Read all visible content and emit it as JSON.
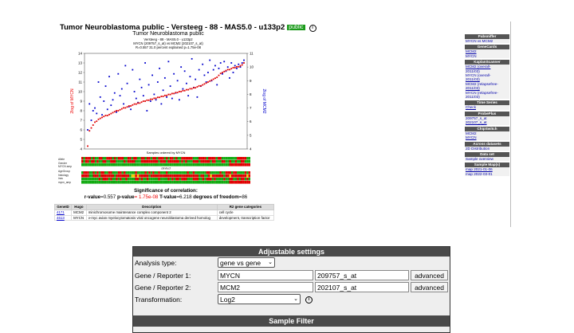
{
  "page": {
    "title": "Tumor Neuroblastoma public - Versteeg - 88 - MAS5.0 - u133p2",
    "badge": "public",
    "info_icon": "info-icon"
  },
  "chart_header": {
    "title": "Tumor Neuroblastoma public",
    "line2": "Versteeg - 88 - MAS5.0 - u133p2",
    "line3": "MYCN (209757_s_at) vs MCM2 (202107_s_at)",
    "line4": "R=0.557 31.0 percent explained p=1.75e-08"
  },
  "chart_data": {
    "type": "scatter",
    "xlabel": "Samples ordered by MYCN",
    "ylabel_left": "2log of MYCN",
    "ylabel_right": "2log of MCM2",
    "ylim_left": [
      4,
      14
    ],
    "yticks_left": [
      "14",
      "13",
      "12",
      "11",
      "10",
      "9",
      "8",
      "7",
      "6",
      "5",
      "4"
    ],
    "ylim_right": [
      4,
      11
    ],
    "yticks_right": [
      "11",
      "10",
      "9",
      "8",
      "7",
      "6",
      "5",
      "4"
    ],
    "series": [
      {
        "name": "MYCN",
        "color": "#e00000",
        "values": [
          4.3,
          5.9,
          6.2,
          6.5,
          6.8,
          6.9,
          7.1,
          7.2,
          7.3,
          7.4,
          7.5,
          7.5,
          7.6,
          7.7,
          7.8,
          7.9,
          8.0,
          8.0,
          8.1,
          8.2,
          8.3,
          8.3,
          8.4,
          8.5,
          8.5,
          8.6,
          8.7,
          8.7,
          8.8,
          8.8,
          8.9,
          9.0,
          9.0,
          9.1,
          9.1,
          9.2,
          9.2,
          9.3,
          9.3,
          9.4,
          9.4,
          9.5,
          9.5,
          9.6,
          9.6,
          9.7,
          9.7,
          9.8,
          9.8,
          9.9,
          9.9,
          10.0,
          10.0,
          10.1,
          10.1,
          10.2,
          10.2,
          10.3,
          10.3,
          10.4,
          10.4,
          10.5,
          10.6,
          10.6,
          10.7,
          10.8,
          10.9,
          11.0,
          11.1,
          11.2,
          11.3,
          11.4,
          11.5,
          11.7,
          11.9,
          12.0,
          12.1,
          12.2,
          12.3,
          12.3,
          12.4,
          12.5,
          12.5,
          12.6,
          12.6,
          12.7,
          12.8,
          13.0
        ]
      },
      {
        "name": "MCM2",
        "color": "#0000cc",
        "values": [
          5.4,
          7.3,
          6.1,
          6.8,
          7.0,
          6.6,
          8.9,
          7.8,
          6.5,
          7.5,
          8.6,
          6.9,
          9.3,
          7.2,
          7.6,
          8.1,
          6.7,
          9.5,
          7.9,
          8.4,
          7.3,
          10.1,
          8.8,
          7.1,
          6.9,
          9.8,
          8.2,
          7.7,
          7.4,
          9.1,
          8.5,
          7.9,
          10.3,
          6.8,
          8.7,
          7.5,
          9.4,
          8.0,
          7.6,
          8.9,
          9.9,
          7.3,
          8.3,
          9.2,
          7.8,
          10.4,
          8.6,
          7.7,
          9.5,
          8.1,
          9.0,
          7.6,
          10.0,
          8.4,
          9.7,
          8.8,
          7.9,
          9.3,
          10.6,
          8.5,
          9.1,
          7.8,
          9.8,
          8.6,
          10.2,
          9.4,
          8.9,
          9.6,
          10.5,
          9.0,
          9.8,
          10.1,
          8.7,
          9.9,
          10.3,
          9.5,
          10.4,
          9.7,
          10.0,
          9.2,
          10.3,
          9.6,
          10.1,
          9.9,
          10.2,
          10.0,
          10.3,
          10.5
        ]
      }
    ]
  },
  "heatmap": {
    "labels_top": [
      "Allele",
      "Gender",
      "MYCN amp"
    ],
    "mid_label": "clin/lecf",
    "labels_bottom": [
      "AgeGroup",
      "histology",
      "inss",
      "mycn_amp"
    ],
    "colors": {
      "red": "#e00000",
      "green": "#11aa11",
      "yellow": "#eecc00",
      "blue": "#2222aa"
    }
  },
  "correlation": {
    "heading": "Significance of correlation:",
    "r_label": "r-value",
    "r_value": "=0.557",
    "p_label": "p-value",
    "p_value": "= 1.75e-08",
    "t_label": "T-value",
    "t_value": "=6.218",
    "dof_label": "degrees of freedom",
    "dof_value": "=86"
  },
  "gene_table": {
    "headers": [
      "GeneID",
      "Hugo",
      "Description",
      "R2 gene categories"
    ],
    "rows": [
      [
        "4171",
        "MCM2",
        "minichromosome maintenance complex component 2",
        "cell cycle"
      ],
      [
        "4613",
        "MYCN",
        "v-myc avian myelocytomatosis viral oncogene neuroblastoma derived homolog",
        "development, transcription factor"
      ]
    ]
  },
  "sidebar": {
    "sections": [
      {
        "title": "Pubsniffer",
        "items": [
          "MYCN vs MCM2"
        ]
      },
      {
        "title": "GeneCards",
        "items": [
          "MCM2",
          "MYCN"
        ]
      },
      {
        "title": "KaplanScanner",
        "items": [
          "MCM2 (overall-",
          "2011/03)",
          "MYCN (overall-",
          "2011/03)",
          "MCM2 (relapsefree-",
          "2011/03)",
          "MYCN (relapsefree-",
          "2011/03)"
        ]
      },
      {
        "title": "Time Series",
        "items": [
          "Check"
        ]
      },
      {
        "title": "ProbePlus",
        "items": [
          "209757_s_at",
          "202107_s_at"
        ]
      },
      {
        "title": "ChipSwitch",
        "items": [
          "MCM2",
          "MYCN"
        ]
      },
      {
        "title": "Across datasets",
        "items": [
          "2D Distribution"
        ]
      },
      {
        "title": "Data set",
        "items": [
          "Sample overview"
        ]
      },
      {
        "title": "Sample Map(s)",
        "items": [
          "map 2021-01-06",
          "map 2022-03-01"
        ]
      }
    ]
  },
  "settings": {
    "header": "Adjustable settings",
    "analysis_type_label": "Analysis type:",
    "analysis_type_value": "gene vs gene",
    "gene1_label": "Gene / Reporter 1:",
    "gene1_value": "MYCN",
    "reporter1_value": "209757_s_at",
    "gene2_label": "Gene / Reporter 2:",
    "gene2_value": "MCM2",
    "reporter2_value": "202107_s_at",
    "advanced_label": "advanced",
    "transformation_label": "Transformation:",
    "transformation_value": "Log2",
    "sample_filter_header": "Sample Filter"
  }
}
